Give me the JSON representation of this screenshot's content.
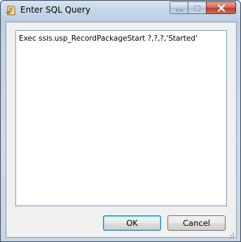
{
  "window": {
    "title": "Enter SQL Query",
    "icons": {
      "app": "sql-script-icon",
      "minimize": "minimize-icon",
      "maximize": "maximize-icon",
      "close": "close-icon"
    }
  },
  "query": {
    "value": "Exec ssis.usp_RecordPackageStart ?,?,?,'Started'"
  },
  "buttons": {
    "ok_label": "OK",
    "cancel_label": "Cancel"
  },
  "colors": {
    "titlebar": "#c3d4e6",
    "close_button": "#c8503a",
    "ok_focus": "#3c7fb1"
  }
}
